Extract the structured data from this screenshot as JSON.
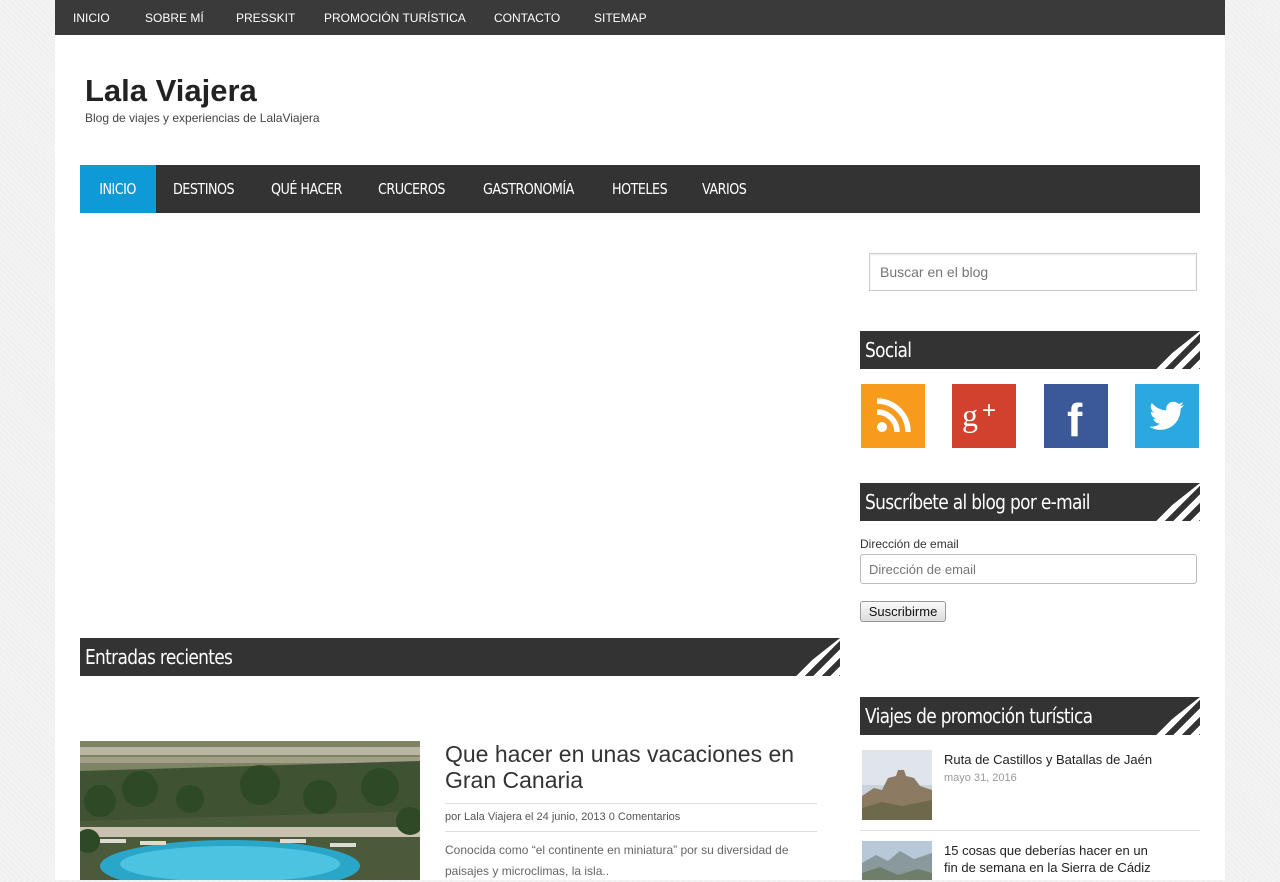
{
  "topnav": [
    "INICIO",
    "SOBRE MÍ",
    "PRESSKIT",
    "PROMOCIÓN TURÍSTICA",
    "CONTACTO",
    "SITEMAP"
  ],
  "site": {
    "title": "Lala Viajera",
    "description": "Blog de viajes y experiencias de LalaViajera"
  },
  "mainnav": [
    "INICIO",
    "DESTINOS",
    "QUÉ HACER",
    "CRUCEROS",
    "GASTRONOMÍA",
    "HOTELES",
    "VARIOS"
  ],
  "recent": {
    "heading": "Entradas recientes",
    "post": {
      "title": "Que hacer en unas vacaciones en Gran Canaria",
      "meta_prefix": "por ",
      "author": "Lala Viajera",
      "meta_mid": " el 24 junio, 2013 ",
      "comments": "0 Comentarios",
      "excerpt": "Conocida como “el continente en miniatura” por su diversidad de paisajes y microclimas, la isla.."
    }
  },
  "sidebar": {
    "search_placeholder": "Buscar en el blog",
    "social_heading": "Social",
    "social_icons": [
      "rss-icon",
      "google-plus-icon",
      "facebook-icon",
      "twitter-icon"
    ],
    "subscribe_heading": "Suscríbete al blog por e-mail",
    "email_label": "Dirección de email",
    "email_placeholder": "Dirección de email",
    "subscribe_button": "Suscribirme",
    "promo_heading": "Viajes de promoción turística",
    "promo_posts": [
      {
        "title": "Ruta de Castillos y Batallas de Jaén",
        "date": "mayo 31, 2016"
      },
      {
        "title": "15 cosas que deberías hacer en un fin de semana en la Sierra de Cádiz",
        "date": ""
      }
    ]
  },
  "colors": {
    "nav_dark": "#333333",
    "accent": "#0e9ad6",
    "rss": "#f89a1c",
    "google_plus": "#d2402e",
    "facebook": "#3b5998",
    "twitter": "#2aa9e0"
  }
}
